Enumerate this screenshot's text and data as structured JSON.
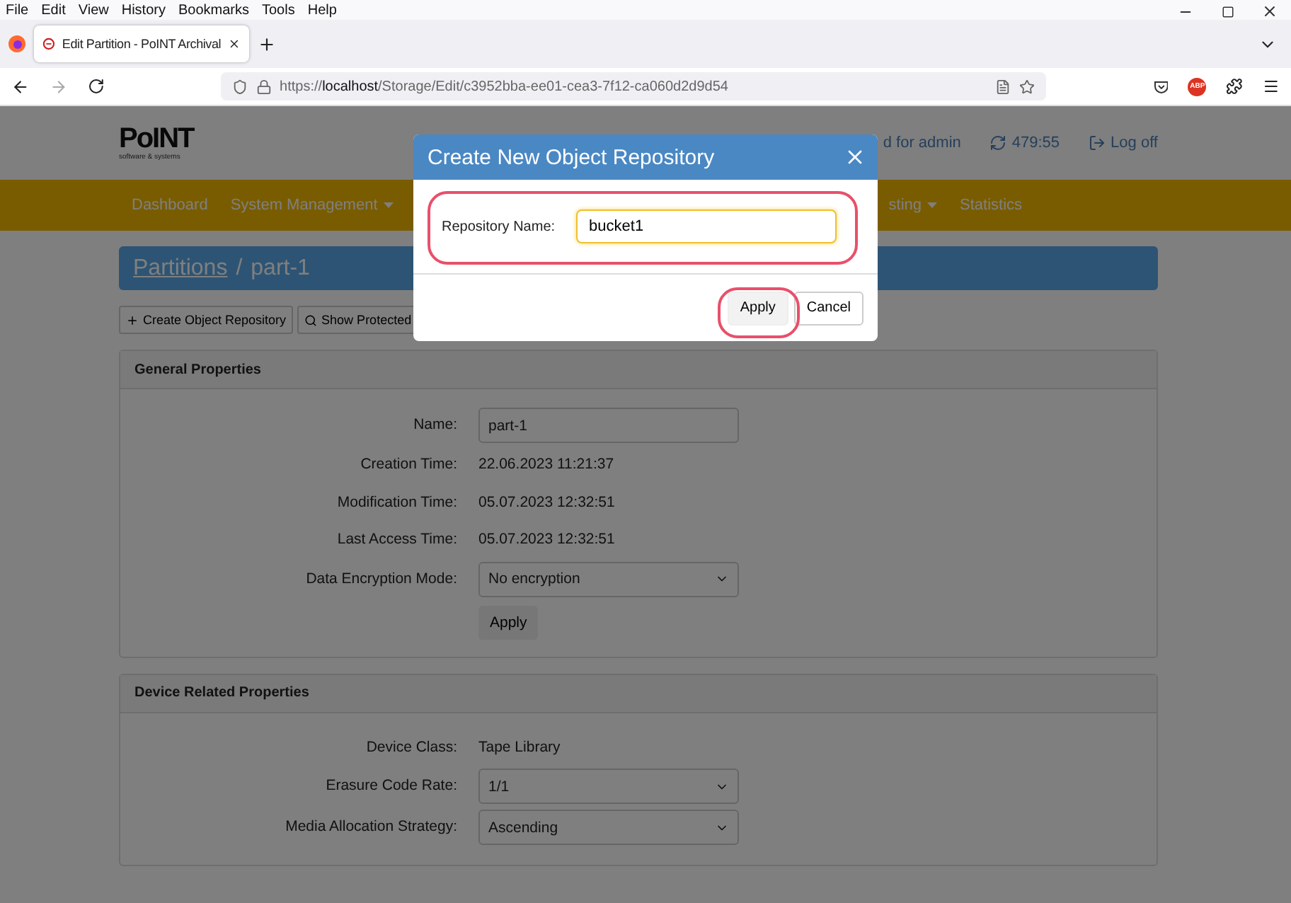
{
  "browser": {
    "menu": [
      "File",
      "Edit",
      "View",
      "History",
      "Bookmarks",
      "Tools",
      "Help"
    ],
    "tab": {
      "title": "Edit Partition - PoINT Archival",
      "selected": true
    },
    "url": {
      "scheme": "https://",
      "host": "localhost",
      "path": "/Storage/Edit/c3952bba-ee01-cea3-7f12-ca060d2d9d54"
    },
    "addon_badge": "ABP"
  },
  "app": {
    "logo": "PoINT",
    "logo_tagline": "software & systems",
    "user": "d for admin",
    "session_timer": "479:55",
    "logout": "Log off",
    "nav": [
      {
        "label": "Dashboard",
        "dropdown": false
      },
      {
        "label": "System Management",
        "dropdown": true
      },
      {
        "label": "sting",
        "dropdown": true
      },
      {
        "label": "Statistics",
        "dropdown": false
      }
    ],
    "breadcrumb": {
      "link": "Partitions",
      "separator": "/",
      "current": "part-1"
    },
    "toolbar": [
      {
        "label": "Create Object Repository"
      },
      {
        "label": "Show Protected"
      }
    ],
    "panels": [
      {
        "title": "General Properties",
        "apply": "Apply",
        "rows": [
          {
            "kind": "input",
            "label": "Name:",
            "value": "part-1"
          },
          {
            "kind": "text",
            "label": "Creation Time:",
            "value": "22.06.2023 11:21:37"
          },
          {
            "kind": "text",
            "label": "Modification Time:",
            "value": "05.07.2023 12:32:51"
          },
          {
            "kind": "text",
            "label": "Last Access Time:",
            "value": "05.07.2023 12:32:51"
          },
          {
            "kind": "select",
            "label": "Data Encryption Mode:",
            "value": "No encryption"
          }
        ]
      },
      {
        "title": "Device Related Properties",
        "rows": [
          {
            "kind": "text",
            "label": "Device Class:",
            "value": "Tape Library"
          },
          {
            "kind": "select",
            "label": "Erasure Code Rate:",
            "value": "1/1"
          },
          {
            "kind": "select",
            "label": "Media Allocation Strategy:",
            "value": "Ascending"
          }
        ]
      }
    ]
  },
  "dialog": {
    "title": "Create New Object Repository",
    "field_label": "Repository Name:",
    "field_value": "bucket1",
    "focused": true,
    "buttons": [
      {
        "label": "Apply",
        "highlighted": true
      },
      {
        "label": "Cancel",
        "highlighted": false
      }
    ],
    "field_highlighted": true
  }
}
